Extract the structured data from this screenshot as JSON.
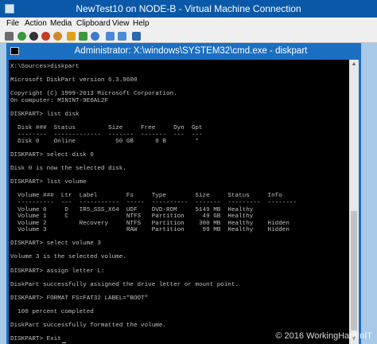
{
  "vm": {
    "title": "NewTest10 on NODE-B - Virtual Machine Connection",
    "icon": "vm-connection-icon",
    "menu": [
      "File",
      "Action",
      "Media",
      "Clipboard",
      "View",
      "Help"
    ],
    "toolbar_icons": [
      {
        "name": "ctrl-alt-del-icon",
        "color": "#6b6b6b"
      },
      {
        "name": "start-icon",
        "color": "#3a9a3a"
      },
      {
        "name": "turn-off-icon",
        "color": "#333333"
      },
      {
        "name": "shutdown-icon",
        "color": "#c83a2a"
      },
      {
        "name": "save-icon",
        "color": "#d08a2a"
      },
      {
        "name": "pause-icon",
        "color": "#e0a020"
      },
      {
        "name": "resume-icon",
        "color": "#3a9a3a"
      },
      {
        "name": "reset-icon",
        "color": "#3a7ad0"
      },
      {
        "name": "checkpoint-icon",
        "color": "#4a8ad8"
      },
      {
        "name": "revert-icon",
        "color": "#4a8ad8"
      },
      {
        "name": "enhanced-session-icon",
        "color": "#2a6ab0"
      }
    ]
  },
  "cmd": {
    "title": "Administrator: X:\\windows\\SYSTEM32\\cmd.exe - diskpart",
    "icon": "cmd-icon",
    "lines": [
      "X:\\Sources>diskpart",
      "",
      "Microsoft DiskPart version 6.3.9600",
      "",
      "Copyright (C) 1999-2013 Microsoft Corporation.",
      "On computer: MININT-9E6AL2F",
      "",
      "DISKPART> list disk",
      "",
      "  Disk ###  Status         Size     Free     Dyn  Gpt",
      "  --------  -------------  -------  -------  ---  ---",
      "  Disk 0    Online           50 GB      0 B        *",
      "",
      "DISKPART> select disk 0",
      "",
      "Disk 0 is now the selected disk.",
      "",
      "DISKPART> list volume",
      "",
      "  Volume ###  Ltr  Label        Fs     Type        Size     Status     Info",
      "  ----------  ---  -----------  -----  ----------  -------  ---------  --------",
      "  Volume 0     D   IR5_SSS_X64  UDF    DVD-ROM     5149 MB  Healthy",
      "  Volume 1     C                NTFS   Partition     49 GB  Healthy",
      "  Volume 2         Recovery     NTFS   Partition    300 MB  Healthy    Hidden",
      "  Volume 3                      RAW    Partition     99 MB  Healthy    Hidden",
      "",
      "DISKPART> select volume 3",
      "",
      "Volume 3 is the selected volume.",
      "",
      "DISKPART> assign letter L:",
      "",
      "DiskPart successfully assigned the drive letter or mount point.",
      "",
      "DISKPART> FORMAT FS=FAT32 LABEL=\"BOOT\"",
      "",
      "  100 percent completed",
      "",
      "DiskPart successfully formatted the volume.",
      "",
      "DISKPART> Exit"
    ]
  },
  "watermark": "© 2016 WorkingHardInIT"
}
